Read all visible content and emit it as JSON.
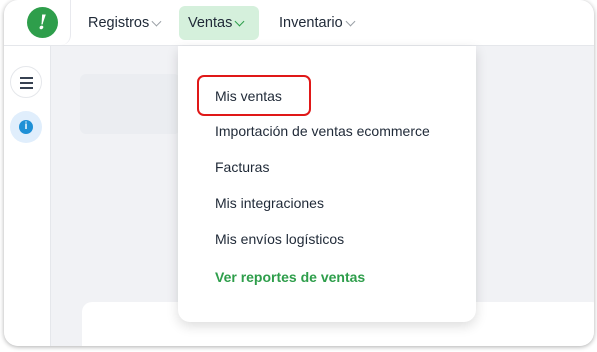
{
  "header": {
    "logo_text": "!",
    "nav": [
      {
        "label": "Registros",
        "active": false
      },
      {
        "label": "Ventas",
        "active": true
      },
      {
        "label": "Inventario",
        "active": false
      }
    ]
  },
  "sidebar": {
    "items": [
      {
        "icon": "menu-icon"
      },
      {
        "icon": "info-icon",
        "glyph": "i"
      }
    ]
  },
  "dropdown": {
    "items": [
      {
        "label": "Mis ventas",
        "highlighted": true
      },
      {
        "label": "Importación de ventas ecommerce"
      },
      {
        "label": "Facturas"
      },
      {
        "label": "Mis integraciones"
      },
      {
        "label": "Mis envíos logísticos"
      }
    ],
    "footer_link": "Ver reportes de ventas"
  },
  "colors": {
    "brand_green": "#2e9e4b",
    "active_tab_bg": "#d5f0dc",
    "highlight_border": "#e01818",
    "info_blue": "#1e90d6"
  }
}
